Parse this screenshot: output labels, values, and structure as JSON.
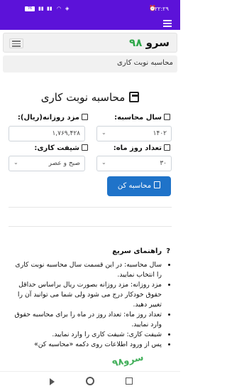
{
  "status_bar": {
    "time": "۲۲:۲۹",
    "battery": "76"
  },
  "navbar": {
    "brand_text": "سرو",
    "brand_number": "۹۸"
  },
  "breadcrumb": {
    "text": "محاسبه نوبت کاری"
  },
  "form": {
    "title": "محاسبه نوبت کاری",
    "year_label": "سال محاسبه:",
    "year_value": "۱۴۰۲",
    "wage_label": "مزد روزانه(ریال):",
    "wage_value": "۱,۷۶۹,۴۲۸",
    "days_label": "تعداد روز ماه:",
    "days_value": "۳۰",
    "shift_label": "شیفت کاری:",
    "shift_value": "صبح و عصر",
    "submit_label": "محاسبه کن"
  },
  "guide": {
    "title": "راهنمای سریع",
    "items": [
      "سال محاسبه: در این قسمت سال محاسبه نوبت کاری را انتخاب نمایید.",
      "مزد روزانه: مزد روزانه بصورت ریال براساس حداقل حقوق خودکار درج می شود ولی شما می توانید آن را تغییر دهید.",
      "تعداد روز ماه: تعداد روز در ماه را برای محاسبه حقوق وارد نمایید.",
      "شیفت کاری: شیفت کاری را وارد نمایید.",
      "پس از ورود اطلاعات روی دکمه «محاسبه کن»"
    ]
  },
  "watermark": {
    "text": "سرو۹۸"
  },
  "colors": {
    "status_bar": "#5c12d9",
    "brand_number": "#2fa84a",
    "button": "#1f73c9"
  }
}
